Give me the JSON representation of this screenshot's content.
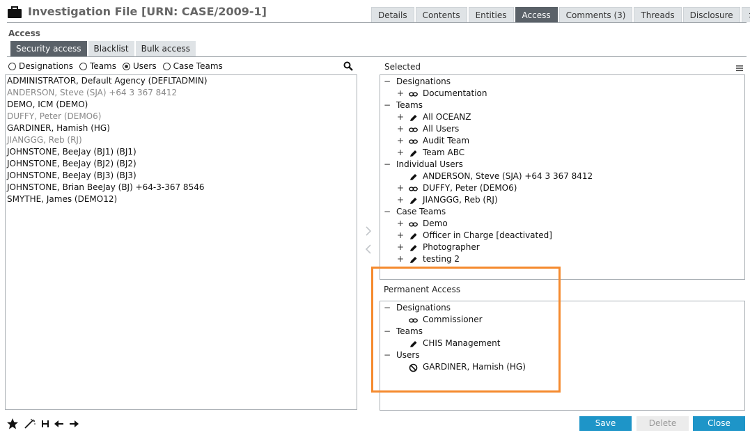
{
  "header": {
    "title": "Investigation File [URN: CASE/2009-1]",
    "tabs": [
      "Details",
      "Contents",
      "Entities",
      "Access",
      "Comments (3)",
      "Threads",
      "Disclosure",
      ">>"
    ],
    "active_tab": "Access"
  },
  "section_label": "Access",
  "subtabs": [
    "Security access",
    "Blacklist",
    "Bulk access"
  ],
  "radios": [
    {
      "label": "Designations",
      "checked": false
    },
    {
      "label": "Teams",
      "checked": false
    },
    {
      "label": "Users",
      "checked": true
    },
    {
      "label": "Case Teams",
      "checked": false
    }
  ],
  "user_list": [
    {
      "text": "ADMINISTRATOR, Default Agency (DEFLTADMIN)",
      "dim": false
    },
    {
      "text": "ANDERSON, Steve (SJA) +64 3 367 8412",
      "dim": true
    },
    {
      "text": "DEMO, ICM (DEMO)",
      "dim": false
    },
    {
      "text": "DUFFY, Peter (DEMO6)",
      "dim": true
    },
    {
      "text": "GARDINER, Hamish (HG)",
      "dim": false
    },
    {
      "text": "JIANGGG, Reb (RJ)",
      "dim": true
    },
    {
      "text": "JOHNSTONE, BeeJay (BJ1) (BJ1)",
      "dim": false
    },
    {
      "text": "JOHNSTONE, BeeJay (BJ2) (BJ2)",
      "dim": false
    },
    {
      "text": "JOHNSTONE, BeeJay (BJ3) (BJ3)",
      "dim": false
    },
    {
      "text": "JOHNSTONE, Brian BeeJay (BJ) +64-3-367 8546",
      "dim": false
    },
    {
      "text": "SMYTHE, James (DEMO12)",
      "dim": false
    }
  ],
  "selected": {
    "label": "Selected",
    "rows": [
      {
        "level": 0,
        "toggle": "−",
        "icon": "",
        "label": "Designations"
      },
      {
        "level": 1,
        "toggle": "+",
        "icon": "link-icon",
        "label": "Documentation"
      },
      {
        "level": 0,
        "toggle": "−",
        "icon": "",
        "label": "Teams"
      },
      {
        "level": 1,
        "toggle": "+",
        "icon": "pencil-icon",
        "label": "All OCEANZ"
      },
      {
        "level": 1,
        "toggle": "+",
        "icon": "link-icon",
        "label": "All Users"
      },
      {
        "level": 1,
        "toggle": "+",
        "icon": "link-icon",
        "label": "Audit Team"
      },
      {
        "level": 1,
        "toggle": "+",
        "icon": "pencil-icon",
        "label": "Team ABC"
      },
      {
        "level": 0,
        "toggle": "−",
        "icon": "",
        "label": "Individual Users"
      },
      {
        "level": 1,
        "toggle": "",
        "icon": "pencil-icon",
        "label": "ANDERSON, Steve (SJA) +64 3 367 8412"
      },
      {
        "level": 1,
        "toggle": "+",
        "icon": "link-icon",
        "label": "DUFFY, Peter (DEMO6)"
      },
      {
        "level": 1,
        "toggle": "+",
        "icon": "pencil-icon",
        "label": "JIANGGG, Reb (RJ)"
      },
      {
        "level": 0,
        "toggle": "−",
        "icon": "",
        "label": "Case Teams"
      },
      {
        "level": 1,
        "toggle": "+",
        "icon": "link-icon",
        "label": "Demo"
      },
      {
        "level": 1,
        "toggle": "+",
        "icon": "pencil-icon",
        "label": "Officer in Charge [deactivated]"
      },
      {
        "level": 1,
        "toggle": "+",
        "icon": "pencil-icon",
        "label": "Photographer"
      },
      {
        "level": 1,
        "toggle": "+",
        "icon": "pencil-icon",
        "label": "testing 2"
      }
    ]
  },
  "permanent": {
    "label": "Permanent Access",
    "rows": [
      {
        "level": 0,
        "toggle": "−",
        "icon": "",
        "label": "Designations"
      },
      {
        "level": 1,
        "toggle": "",
        "icon": "link-icon",
        "label": "Commissioner"
      },
      {
        "level": 0,
        "toggle": "−",
        "icon": "",
        "label": "Teams"
      },
      {
        "level": 1,
        "toggle": "",
        "icon": "pencil-icon",
        "label": "CHIS Management"
      },
      {
        "level": 0,
        "toggle": "−",
        "icon": "",
        "label": "Users"
      },
      {
        "level": 1,
        "toggle": "",
        "icon": "blocked-icon",
        "label": "GARDINER, Hamish (HG)"
      }
    ]
  },
  "buttons": {
    "save": "Save",
    "delete": "Delete",
    "close": "Close"
  },
  "highlight_color": "#f58a2e",
  "accent_color": "#1e95c8"
}
